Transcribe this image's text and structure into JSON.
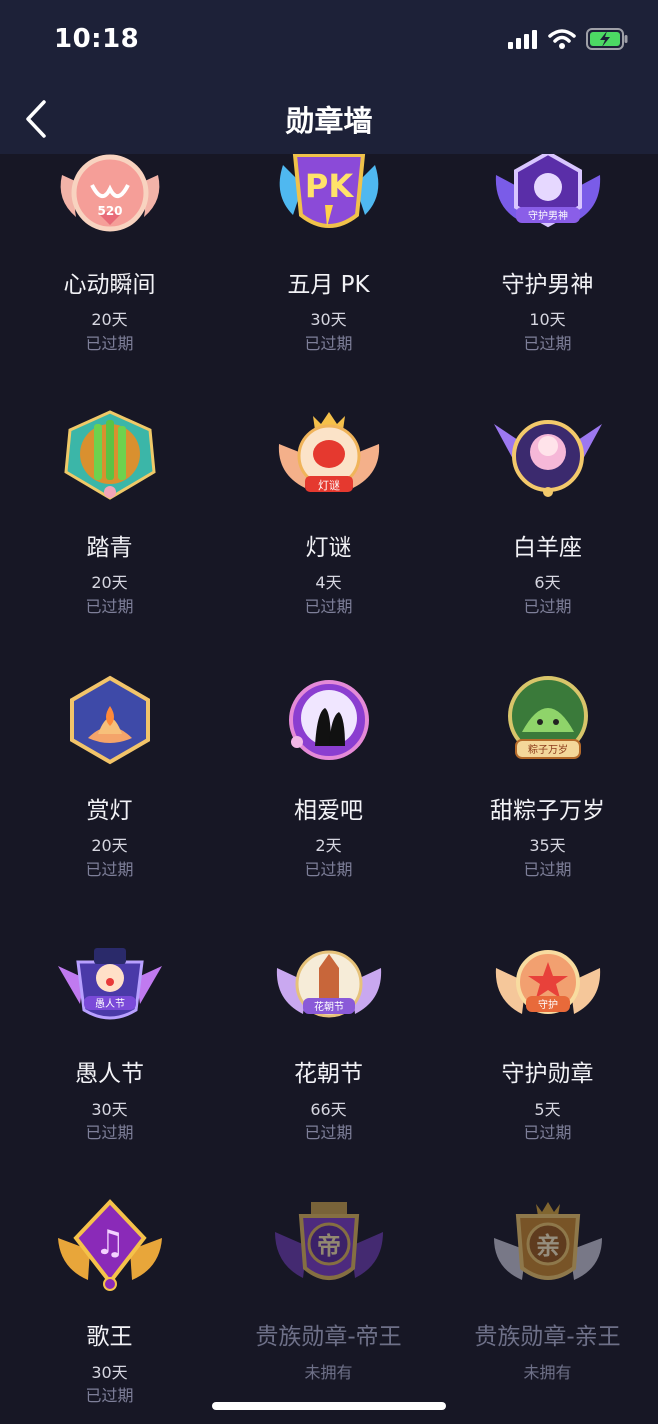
{
  "status_bar": {
    "time": "10:18"
  },
  "nav": {
    "title": "勋章墙"
  },
  "colors": {
    "background": "#171725",
    "nav": "#1d2138",
    "expired": "#7e7f99",
    "battery": "#4cd964"
  },
  "badges": [
    {
      "name": "心动瞬间",
      "days": "20天",
      "status": "已过期",
      "icon": "heart-wings-520-badge-icon",
      "icon_text": "520",
      "owned": true
    },
    {
      "name": "五月 PK",
      "days": "30天",
      "status": "已过期",
      "icon": "pk-badge-icon",
      "icon_text": "PK",
      "owned": true
    },
    {
      "name": "守护男神",
      "days": "10天",
      "status": "已过期",
      "icon": "guardian-god-badge-icon",
      "icon_text": "守护男神",
      "owned": true
    },
    {
      "name": "踏青",
      "days": "20天",
      "status": "已过期",
      "icon": "bamboo-badge-icon",
      "icon_text": "",
      "owned": true
    },
    {
      "name": "灯谜",
      "days": "4天",
      "status": "已过期",
      "icon": "lantern-riddle-badge-icon",
      "icon_text": "灯谜",
      "owned": true
    },
    {
      "name": "白羊座",
      "days": "6天",
      "status": "已过期",
      "icon": "aries-girl-badge-icon",
      "icon_text": "",
      "owned": true
    },
    {
      "name": "赏灯",
      "days": "20天",
      "status": "已过期",
      "icon": "lotus-lamp-badge-icon",
      "icon_text": "",
      "owned": true
    },
    {
      "name": "相爱吧",
      "days": "2天",
      "status": "已过期",
      "icon": "couple-moon-badge-icon",
      "icon_text": "",
      "owned": true
    },
    {
      "name": "甜粽子万岁",
      "days": "35天",
      "status": "已过期",
      "icon": "zongzi-badge-icon",
      "icon_text": "粽子万岁",
      "owned": true
    },
    {
      "name": "愚人节",
      "days": "30天",
      "status": "已过期",
      "icon": "clown-badge-icon",
      "icon_text": "愚人节",
      "owned": true
    },
    {
      "name": "花朝节",
      "days": "66天",
      "status": "已过期",
      "icon": "pagoda-badge-icon",
      "icon_text": "花朝节",
      "owned": true
    },
    {
      "name": "守护勋章",
      "days": "5天",
      "status": "已过期",
      "icon": "guard-medal-badge-icon",
      "icon_text": "守护",
      "owned": true
    },
    {
      "name": "歌王",
      "days": "30天",
      "status": "已过期",
      "icon": "music-king-badge-icon",
      "icon_text": "",
      "owned": true
    },
    {
      "name": "贵族勋章-帝王",
      "days": "",
      "status": "未拥有",
      "icon": "emperor-badge-icon",
      "icon_text": "帝",
      "owned": false
    },
    {
      "name": "贵族勋章-亲王",
      "days": "",
      "status": "未拥有",
      "icon": "prince-badge-icon",
      "icon_text": "亲",
      "owned": false
    }
  ]
}
